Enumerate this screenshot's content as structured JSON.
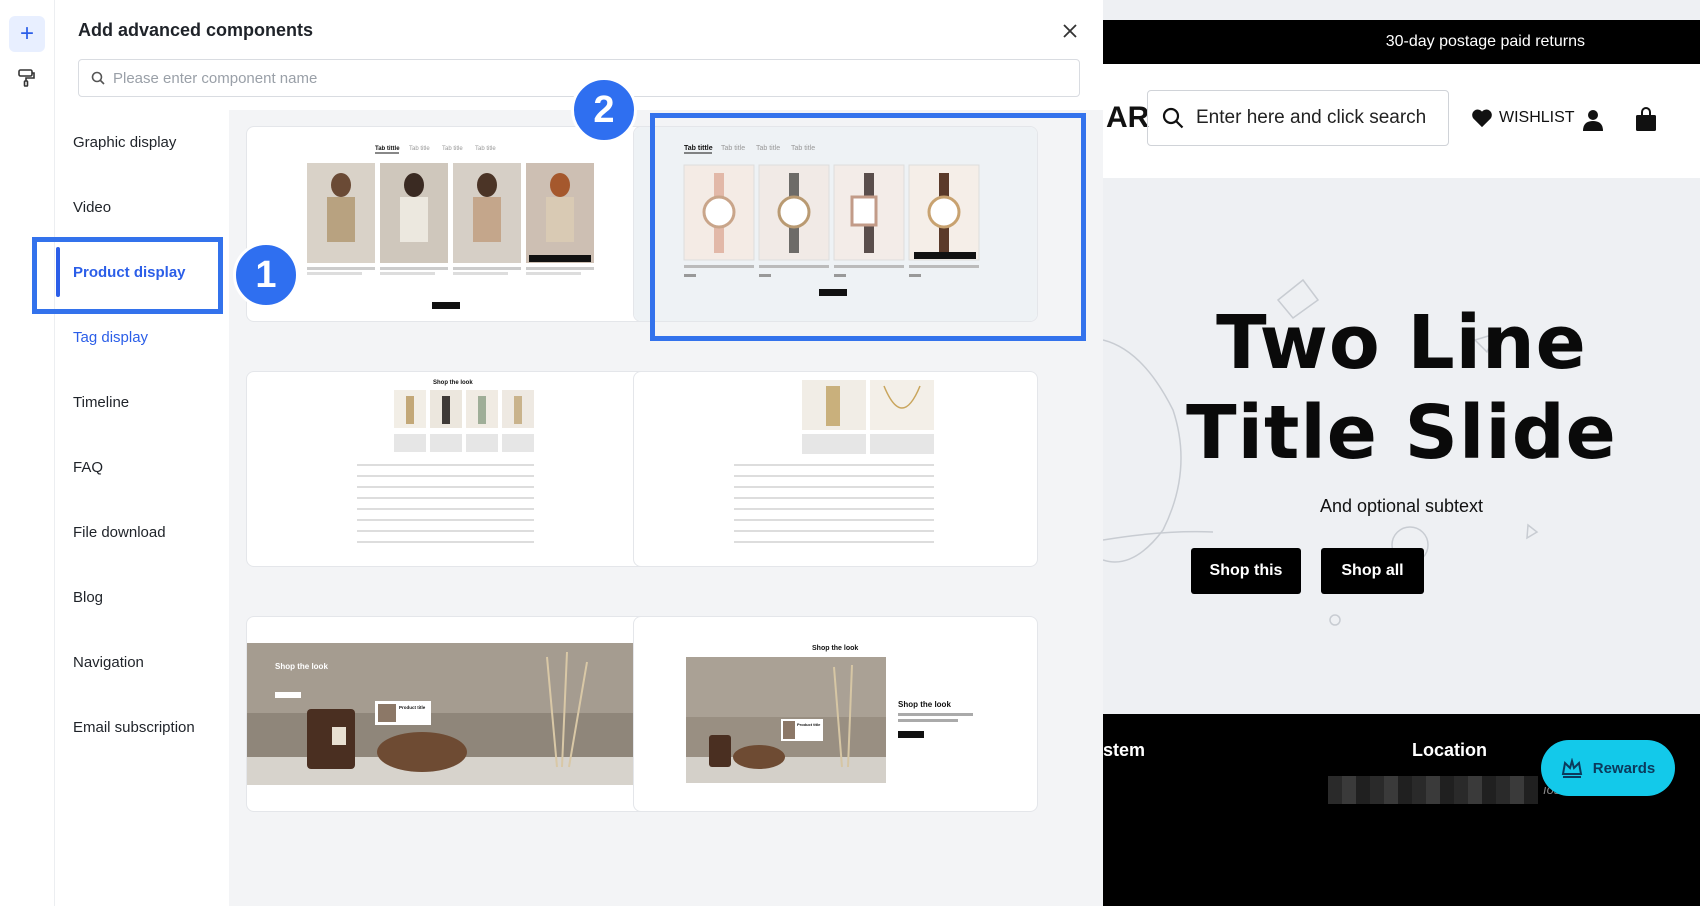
{
  "panel": {
    "title": "Add advanced components",
    "search_placeholder": "Please enter component name"
  },
  "categories": [
    {
      "label": "Graphic display",
      "state": "normal"
    },
    {
      "label": "Video",
      "state": "normal"
    },
    {
      "label": "Product display",
      "state": "selected"
    },
    {
      "label": "Tag display",
      "state": "link"
    },
    {
      "label": "Timeline",
      "state": "normal"
    },
    {
      "label": "FAQ",
      "state": "normal"
    },
    {
      "label": "File download",
      "state": "normal"
    },
    {
      "label": "Blog",
      "state": "normal"
    },
    {
      "label": "Navigation",
      "state": "normal"
    },
    {
      "label": "Email subscription",
      "state": "normal"
    }
  ],
  "annotations": {
    "badge1": "1",
    "badge2": "2"
  },
  "cards": {
    "tab_label_active": "Tab tittle",
    "tab_label": "Tab title",
    "shop_look": "Shop the look",
    "product_title": "Product title"
  },
  "site": {
    "announcement": "30-day postage paid returns",
    "logo_fragment": "AR",
    "search_placeholder": "Enter here and click search",
    "wishlist": "WISHLIST",
    "hero_line1": "Two Line",
    "hero_line2": "Title Slide",
    "hero_sub": "And optional subtext",
    "btn_shop_this": "Shop this",
    "btn_shop_all": "Shop all",
    "footer_left": "stem",
    "footer_location": "Location",
    "footer_tail": "ıos",
    "rewards": "Rewards"
  },
  "colors": {
    "accent": "#2b5ee8",
    "annotation": "#3372ec",
    "rewards": "#13c9ea"
  }
}
